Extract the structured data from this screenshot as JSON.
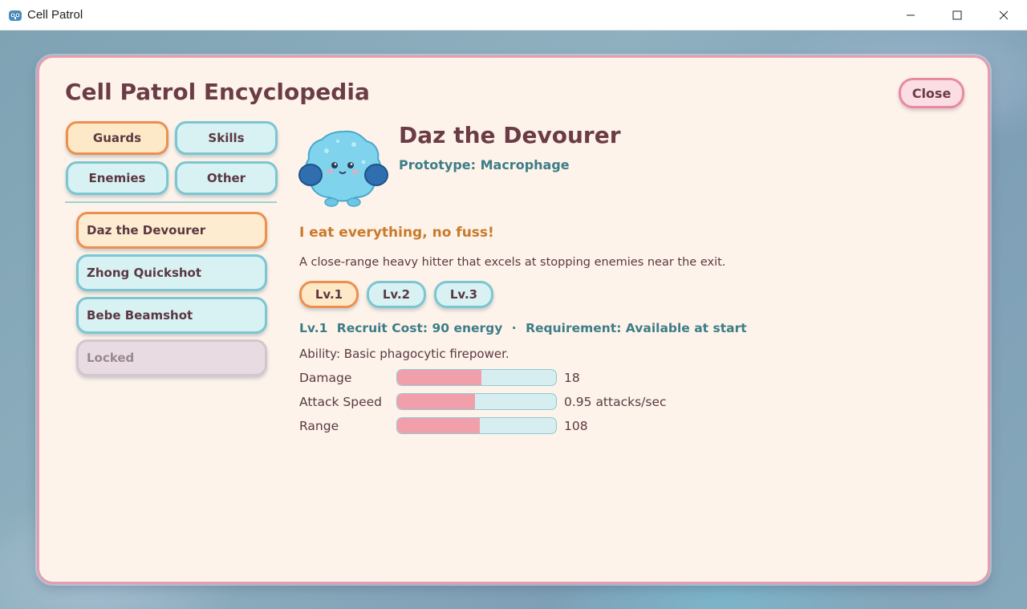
{
  "window": {
    "title": "Cell Patrol",
    "icons": {
      "app": "godot-icon",
      "minimize": "minimize-icon",
      "maximize": "maximize-icon",
      "close": "close-icon"
    }
  },
  "panel": {
    "title": "Cell Patrol Encyclopedia",
    "close_label": "Close"
  },
  "categories": [
    {
      "label": "Guards",
      "active": true
    },
    {
      "label": "Skills",
      "active": false
    },
    {
      "label": "Enemies",
      "active": false
    },
    {
      "label": "Other",
      "active": false
    }
  ],
  "entries": [
    {
      "label": "Daz the Devourer",
      "state": "active"
    },
    {
      "label": "Zhong Quickshot",
      "state": "normal"
    },
    {
      "label": "Bebe Beamshot",
      "state": "normal"
    },
    {
      "label": "Locked",
      "state": "locked"
    }
  ],
  "detail": {
    "name": "Daz the Devourer",
    "prototype": "Prototype: Macrophage",
    "quote": "I eat everything, no fuss!",
    "description": "A close-range heavy hitter that excels at stopping enemies near the exit.",
    "levels": [
      {
        "label": "Lv.1",
        "active": true
      },
      {
        "label": "Lv.2",
        "active": false
      },
      {
        "label": "Lv.3",
        "active": false
      }
    ],
    "level_info": {
      "level": "Lv.1",
      "cost": "Recruit Cost: 90 energy",
      "separator": "·",
      "requirement": "Requirement: Available at start"
    },
    "ability": "Ability: Basic phagocytic firepower.",
    "stats": [
      {
        "label": "Damage",
        "value": "18",
        "fill": 0.53
      },
      {
        "label": "Attack Speed",
        "value": "0.95 attacks/sec",
        "fill": 0.49
      },
      {
        "label": "Range",
        "value": "108",
        "fill": 0.52
      }
    ]
  },
  "colors": {
    "panel_bg": "#fdf3ea",
    "panel_border": "#e59cb0",
    "accent_orange": "#ee8f4e",
    "accent_teal": "#7cc6d1",
    "bar_fill": "#f1a0ab"
  }
}
